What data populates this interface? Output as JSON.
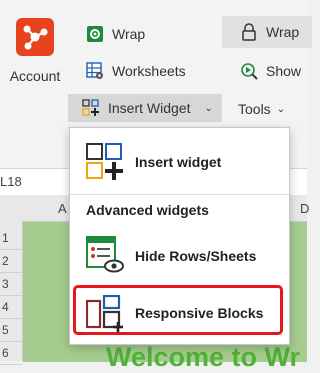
{
  "ribbon": {
    "account_label": "Account",
    "wrap_label": "Wrap",
    "worksheets_label": "Worksheets",
    "insert_widget_label": "Insert Widget",
    "wrap2_label": "Wrap",
    "show_label": "Show",
    "tools_label": "Tools"
  },
  "sheet": {
    "cell_ref": "L18",
    "columns": [
      "A",
      "D"
    ],
    "rows": [
      "1",
      "2",
      "3",
      "4",
      "5",
      "6"
    ],
    "welcome_text": "Welcome to Wr"
  },
  "menu": {
    "insert_widget_item": "Insert widget",
    "section_title": "Advanced widgets",
    "hide_rows_item": "Hide Rows/Sheets",
    "responsive_blocks_item": "Responsive Blocks"
  },
  "colors": {
    "brand": "#e8431f",
    "highlight": "#e8151b",
    "sheet_green": "#a5cc8e",
    "icon_blue": "#1e5fb3",
    "icon_orange": "#f0a30a",
    "icon_green": "#1f8a3c",
    "icon_maroon": "#8b2a2a"
  },
  "icons": {
    "account": "account-logo-icon",
    "wrap": "wrap-icon",
    "worksheets": "worksheets-icon",
    "insert_widget": "insert-widget-icon",
    "wrap2": "lock-icon",
    "show": "show-icon",
    "menu_insert": "insert-widget-grid-icon",
    "menu_hide": "hide-rows-icon",
    "menu_responsive": "responsive-blocks-icon"
  }
}
